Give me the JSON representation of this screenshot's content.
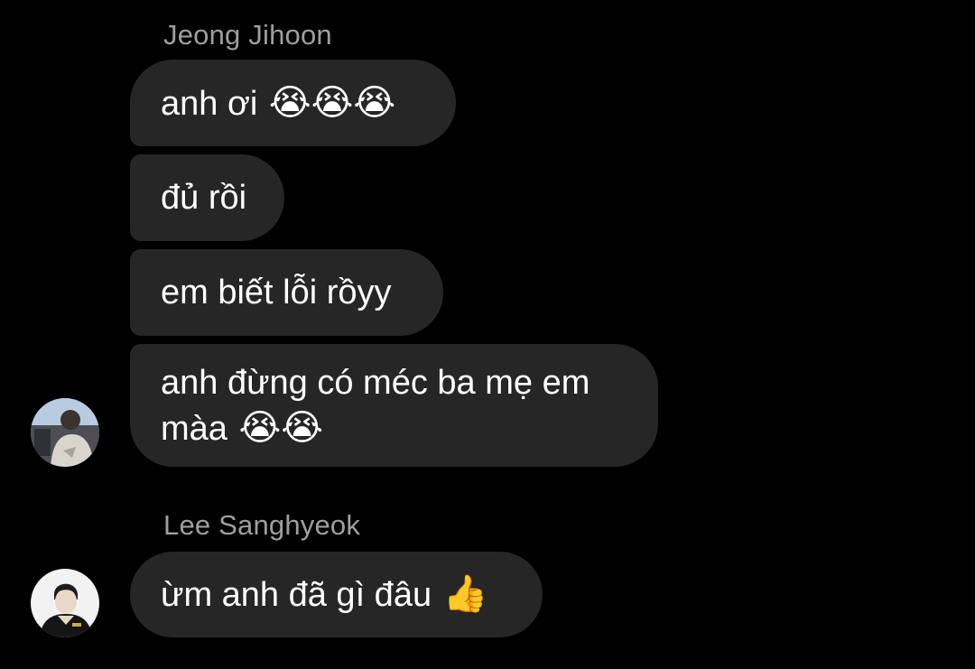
{
  "conversation": {
    "groups": [
      {
        "sender": "Jeong Jihoon",
        "avatar_icon": "user-photo-icon",
        "messages": [
          {
            "text": "anh ơi",
            "emoji": "😭😭😭"
          },
          {
            "text": "đủ rồi",
            "emoji": ""
          },
          {
            "text": "em biết lỗi rồyy",
            "emoji": ""
          },
          {
            "text": "anh đừng có méc ba mẹ em màa",
            "emoji": "😭😭"
          }
        ]
      },
      {
        "sender": "Lee Sanghyeok",
        "avatar_icon": "user-photo-icon",
        "messages": [
          {
            "text": "ừm anh đã gì đâu",
            "emoji": "👍"
          }
        ]
      }
    ]
  },
  "colors": {
    "background": "#000000",
    "bubble": "#262626",
    "sender_name": "#9e9e9e",
    "text": "#ffffff"
  }
}
